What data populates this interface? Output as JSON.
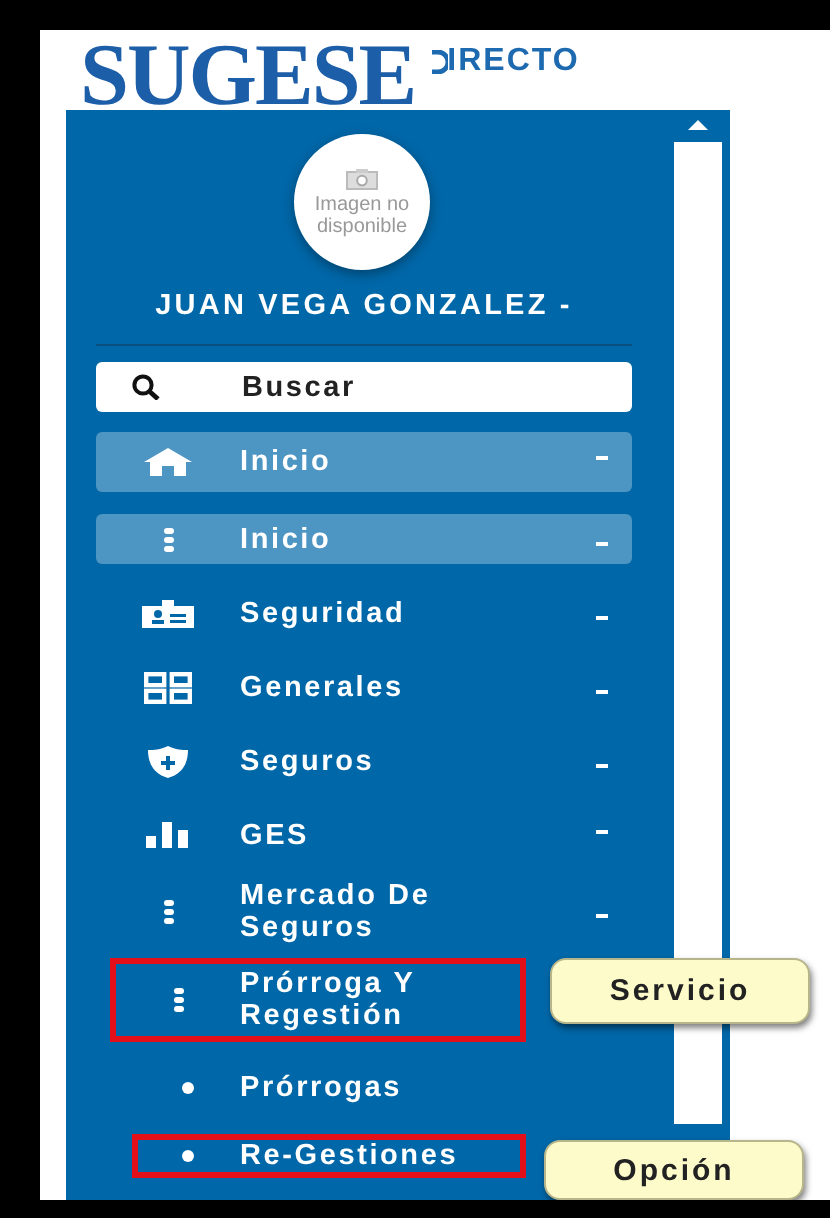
{
  "logo": {
    "main": "SUGESE",
    "sub": "IRECTO"
  },
  "profile": {
    "photo_text": "Imagen no disponible",
    "user_name": "JUAN VEGA GONZALEZ -"
  },
  "search": {
    "placeholder": "Buscar"
  },
  "menu": [
    {
      "kind": "group",
      "label": "Inicio",
      "highlighted": true,
      "expanded": true
    },
    {
      "kind": "group",
      "label": "Inicio",
      "highlighted": true,
      "expanded": false
    },
    {
      "kind": "group",
      "label": "Seguridad",
      "highlighted": false,
      "expanded": false
    },
    {
      "kind": "group",
      "label": "Generales",
      "highlighted": false,
      "expanded": false
    },
    {
      "kind": "group",
      "label": "Seguros",
      "highlighted": false,
      "expanded": false
    },
    {
      "kind": "group",
      "label": "GES",
      "highlighted": false,
      "expanded": true
    },
    {
      "kind": "group",
      "label": "Mercado De Seguros",
      "highlighted": false,
      "expanded": false
    },
    {
      "kind": "folder",
      "label": "Prórroga Y Regestión",
      "highlighted": false,
      "annotation": "Servicio"
    },
    {
      "kind": "sub",
      "label": "Prórrogas",
      "highlighted": false
    },
    {
      "kind": "sub",
      "label": "Re-Gestiones",
      "highlighted": false,
      "annotation": "Opción"
    }
  ]
}
